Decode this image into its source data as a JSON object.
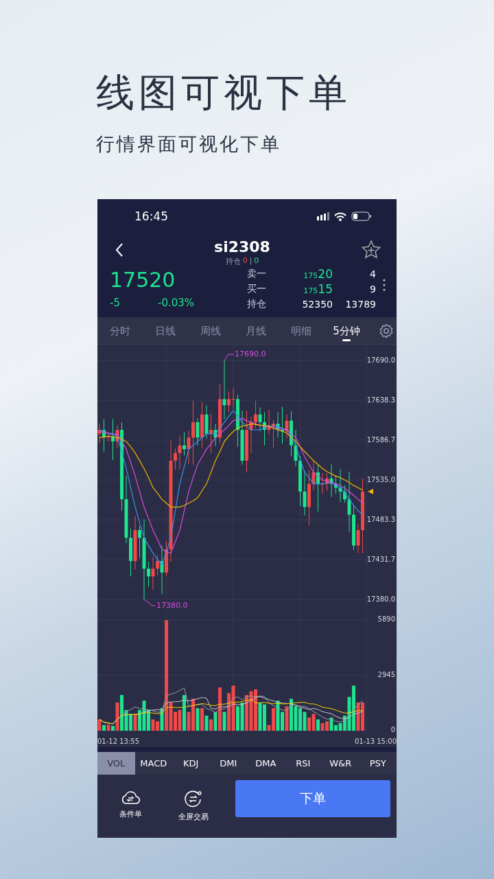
{
  "promo": {
    "headline": "线图可视下单",
    "subtitle": "行情界面可视化下单"
  },
  "status_bar": {
    "time": "16:45"
  },
  "header": {
    "title": "si2308",
    "position_label": "持仓",
    "position_long": "0",
    "position_separator": "|",
    "position_short": "0"
  },
  "quote": {
    "last_price": "17520",
    "change": "-5",
    "change_percent": "-0.03%",
    "rows": [
      {
        "kind": "split",
        "label": "卖一",
        "price_head": "175",
        "price_tail": "20",
        "value": "4"
      },
      {
        "kind": "split",
        "label": "买一",
        "price_head": "175",
        "price_tail": "15",
        "value": "9"
      },
      {
        "kind": "plain",
        "label": "持仓",
        "price": "52350",
        "value": "13789"
      }
    ]
  },
  "period_tabs": [
    {
      "label": "分时",
      "selected": false
    },
    {
      "label": "日线",
      "selected": false
    },
    {
      "label": "周线",
      "selected": false
    },
    {
      "label": "月线",
      "selected": false
    },
    {
      "label": "明细",
      "selected": false
    },
    {
      "label": "5分钟",
      "selected": true
    }
  ],
  "price_chart": {
    "high_label": "17690.0",
    "low_label": "17380.0",
    "chart_data": {
      "type": "candlestick",
      "grid": true,
      "ylim": [
        17380,
        17690
      ],
      "yticks": [
        {
          "value": 17690,
          "label": "17690.0"
        },
        {
          "value": 17638.3,
          "label": "17638.3"
        },
        {
          "value": 17586.7,
          "label": "17586.7"
        },
        {
          "value": 17535,
          "label": "17535.0"
        },
        {
          "value": 17483.3,
          "label": "17483.3"
        },
        {
          "value": 17431.7,
          "label": "17431.7"
        },
        {
          "value": 17380,
          "label": "17380.0"
        }
      ],
      "ohlc": [
        [
          17595,
          17608,
          17583,
          17600
        ],
        [
          17600,
          17614,
          17572,
          17590
        ],
        [
          17590,
          17596,
          17585,
          17592
        ],
        [
          17592,
          17614,
          17561,
          17585
        ],
        [
          17585,
          17606,
          17576,
          17600
        ],
        [
          17600,
          17610,
          17495,
          17510
        ],
        [
          17510,
          17540,
          17453,
          17460
        ],
        [
          17460,
          17472,
          17410,
          17430
        ],
        [
          17430,
          17488,
          17419,
          17470
        ],
        [
          17470,
          17475,
          17434,
          17460
        ],
        [
          17460,
          17484,
          17380,
          17420
        ],
        [
          17420,
          17429,
          17397,
          17410
        ],
        [
          17410,
          17435,
          17393,
          17420
        ],
        [
          17420,
          17437,
          17411,
          17430
        ],
        [
          17430,
          17450,
          17387,
          17415
        ],
        [
          17415,
          17456,
          17410,
          17445
        ],
        [
          17445,
          17586,
          17429,
          17560
        ],
        [
          17560,
          17576,
          17548,
          17570
        ],
        [
          17570,
          17593,
          17549,
          17580
        ],
        [
          17580,
          17597,
          17567,
          17575
        ],
        [
          17575,
          17599,
          17556,
          17590
        ],
        [
          17590,
          17638,
          17555,
          17610
        ],
        [
          17610,
          17615,
          17580,
          17590
        ],
        [
          17590,
          17636,
          17576,
          17620
        ],
        [
          17620,
          17632,
          17589,
          17595
        ],
        [
          17595,
          17621,
          17570,
          17600
        ],
        [
          17600,
          17608,
          17579,
          17590
        ],
        [
          17590,
          17659,
          17583,
          17640
        ],
        [
          17640,
          17690,
          17614,
          17632
        ],
        [
          17632,
          17650,
          17623,
          17640
        ],
        [
          17640,
          17654,
          17627,
          17640
        ],
        [
          17640,
          17646,
          17578,
          17600
        ],
        [
          17600,
          17625,
          17555,
          17560
        ],
        [
          17560,
          17625,
          17545,
          17600
        ],
        [
          17600,
          17617,
          17570,
          17610
        ],
        [
          17610,
          17638,
          17602,
          17620
        ],
        [
          17620,
          17629,
          17598,
          17610
        ],
        [
          17610,
          17623,
          17580,
          17600
        ],
        [
          17600,
          17626,
          17594,
          17604
        ],
        [
          17604,
          17613,
          17577,
          17608
        ],
        [
          17608,
          17623,
          17590,
          17600
        ],
        [
          17600,
          17630,
          17582,
          17598
        ],
        [
          17598,
          17620,
          17589,
          17612
        ],
        [
          17612,
          17624,
          17566,
          17580
        ],
        [
          17580,
          17600,
          17553,
          17560
        ],
        [
          17560,
          17566,
          17501,
          17520
        ],
        [
          17520,
          17547,
          17489,
          17500
        ],
        [
          17500,
          17548,
          17476,
          17530
        ],
        [
          17530,
          17561,
          17522,
          17545
        ],
        [
          17545,
          17554,
          17494,
          17530
        ],
        [
          17530,
          17544,
          17517,
          17530
        ],
        [
          17530,
          17544,
          17521,
          17537
        ],
        [
          17537,
          17556,
          17513,
          17530
        ],
        [
          17530,
          17541,
          17517,
          17525
        ],
        [
          17525,
          17549,
          17506,
          17520
        ],
        [
          17520,
          17528,
          17506,
          17510
        ],
        [
          17510,
          17546,
          17468,
          17490
        ],
        [
          17490,
          17503,
          17444,
          17450
        ],
        [
          17450,
          17479,
          17440,
          17470
        ],
        [
          17470,
          17537,
          17440,
          17520
        ]
      ],
      "series": [
        {
          "type": "line",
          "color": "#3d8ff0",
          "values": [
            17600,
            17598,
            17595,
            17594,
            17592,
            17571,
            17550,
            17525,
            17500,
            17480,
            17460,
            17450,
            17440,
            17432,
            17425,
            17442,
            17460,
            17495,
            17530,
            17552,
            17575,
            17580,
            17585,
            17590,
            17595,
            17595,
            17595,
            17602,
            17610,
            17618,
            17625,
            17618,
            17610,
            17605,
            17600,
            17600,
            17600,
            17602,
            17605,
            17605,
            17605,
            17602,
            17600,
            17590,
            17580,
            17562,
            17545,
            17538,
            17530,
            17530,
            17530,
            17531,
            17532,
            17528,
            17525,
            17518,
            17510,
            17502,
            17495,
            17490
          ]
        },
        {
          "type": "line",
          "color": "#d84de0",
          "values": [
            17598,
            17597,
            17596,
            17595,
            17594,
            17585,
            17575,
            17558,
            17540,
            17520,
            17500,
            17485,
            17470,
            17458,
            17445,
            17442,
            17440,
            17455,
            17470,
            17495,
            17520,
            17538,
            17555,
            17565,
            17575,
            17582,
            17590,
            17595,
            17600,
            17606,
            17612,
            17614,
            17615,
            17612,
            17610,
            17608,
            17606,
            17605,
            17604,
            17603,
            17602,
            17601,
            17600,
            17595,
            17590,
            17578,
            17565,
            17555,
            17545,
            17540,
            17535,
            17534,
            17532,
            17530,
            17528,
            17524,
            17520,
            17515,
            17510,
            17505
          ]
        },
        {
          "type": "line",
          "color": "#f0b400",
          "values": [
            17590,
            17591,
            17592,
            17591,
            17590,
            17588,
            17585,
            17578,
            17570,
            17560,
            17550,
            17538,
            17525,
            17518,
            17510,
            17505,
            17500,
            17500,
            17500,
            17502,
            17505,
            17508,
            17512,
            17521,
            17530,
            17545,
            17560,
            17572,
            17585,
            17592,
            17598,
            17602,
            17605,
            17606,
            17608,
            17607,
            17606,
            17606,
            17605,
            17602,
            17600,
            17598,
            17596,
            17590,
            17585,
            17578,
            17572,
            17566,
            17560,
            17555,
            17550,
            17546,
            17543,
            17540,
            17538,
            17535,
            17532,
            17528,
            17525,
            17522
          ]
        }
      ]
    }
  },
  "volume_chart": {
    "axis_labels": [
      "5890",
      "2945",
      "0"
    ],
    "start_time": "01-12 13:55",
    "end_time": "01-13 15:00"
  },
  "indicator_tabs": [
    {
      "label": "VOL",
      "selected": true
    },
    {
      "label": "MACD",
      "selected": false
    },
    {
      "label": "KDJ",
      "selected": false
    },
    {
      "label": "DMI",
      "selected": false
    },
    {
      "label": "DMA",
      "selected": false
    },
    {
      "label": "RSI",
      "selected": false
    },
    {
      "label": "W&R",
      "selected": false
    },
    {
      "label": "PSY",
      "selected": false
    }
  ],
  "actions": {
    "conditional_order": "条件单",
    "fullscreen_trade": "全屏交易",
    "place_order": "下单"
  }
}
